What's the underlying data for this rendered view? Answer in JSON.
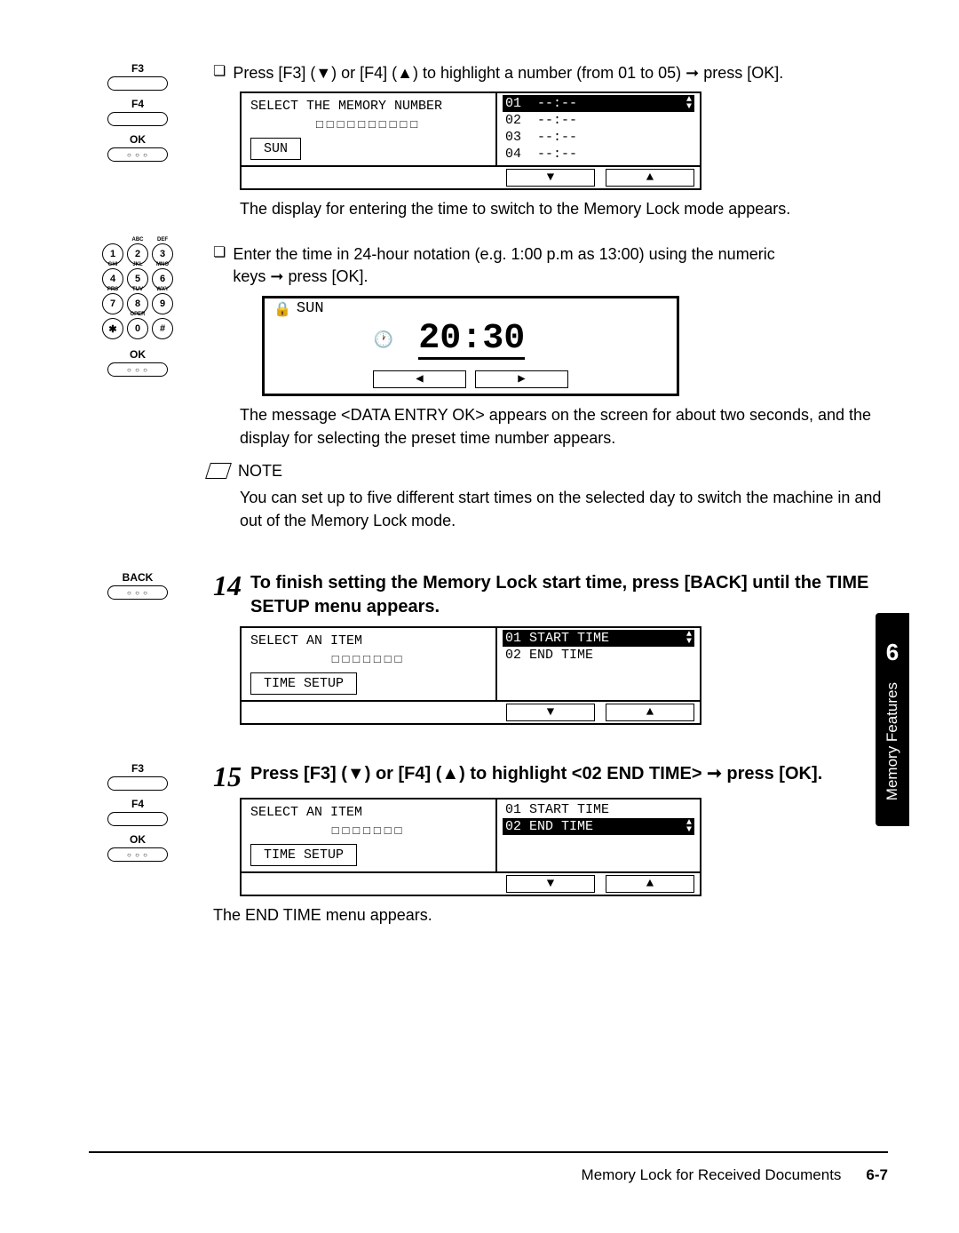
{
  "keys": {
    "f3": "F3",
    "f4": "F4",
    "ok": "OK",
    "back": "BACK"
  },
  "keypad": {
    "r1": [
      "1",
      "2",
      "3"
    ],
    "t1": [
      "",
      "ABC",
      "DEF"
    ],
    "r2": [
      "4",
      "5",
      "6"
    ],
    "t2": [
      "GHI",
      "JKL",
      "MNO"
    ],
    "r3": [
      "7",
      "8",
      "9"
    ],
    "t3": [
      "PRS",
      "TUV",
      "WXY"
    ],
    "r4": [
      "✱",
      "0",
      "#"
    ],
    "t4": [
      "",
      "OPER",
      ""
    ]
  },
  "bullet1": "Press [F3] (▼) or [F4] (▲) to highlight a number (from 01 to 05) ➞ press [OK].",
  "lcdA": {
    "title": "SELECT THE MEMORY NUMBER",
    "dots": "□□□□□□□□□□",
    "box": "SUN",
    "items": [
      "01  --:--",
      "02  --:--",
      "03  --:--",
      "04  --:--"
    ],
    "sel": 0
  },
  "descA": "The display for entering the time to switch to the Memory Lock mode appears.",
  "bullet2a": "Enter the time in 24-hour notation (e.g. 1:00 p.m as 13:00) using the numeric",
  "bullet2b": "keys ➞ press [OK].",
  "lcdB": {
    "title": "SUN",
    "time": "20:30"
  },
  "descB": "The message <DATA ENTRY OK> appears on the screen for about two seconds, and the display for selecting the preset time number appears.",
  "noteLabel": "NOTE",
  "noteText": "You can set up to five different start times on the selected day to switch the machine in and out of the Memory Lock mode.",
  "step14num": "14",
  "step14": "To finish setting the Memory Lock start time, press [BACK] until the TIME SETUP menu appears.",
  "lcdC": {
    "title": "SELECT AN ITEM",
    "dots": "□□□□□□□",
    "box": "TIME SETUP",
    "items": [
      "01 START TIME",
      "02 END TIME"
    ],
    "sel": 0
  },
  "step15num": "15",
  "step15": "Press [F3] (▼) or [F4] (▲) to highlight <02 END TIME> ➞ press [OK].",
  "lcdD": {
    "title": "SELECT AN ITEM",
    "dots": "□□□□□□□",
    "box": "TIME SETUP",
    "items": [
      "01 START TIME",
      "02 END TIME"
    ],
    "sel": 1
  },
  "descD": "The END TIME menu appears.",
  "tabNum": "6",
  "tabText": "Memory Features",
  "footerText": "Memory Lock for Received Documents",
  "pageNum": "6-7"
}
